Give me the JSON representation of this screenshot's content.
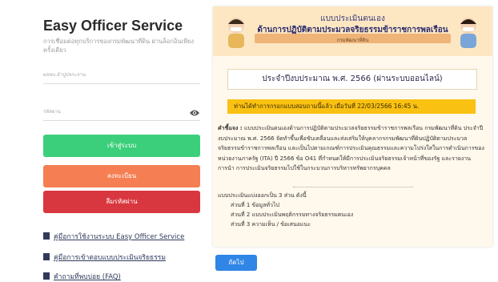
{
  "login": {
    "title": "Easy Officer Service",
    "subtitle": "การเชื่อมต่อทุกบริการของกรมพัฒนาที่ดิน ผ่านล็อกอินเพียงครั้งเดียว",
    "username_placeholder": "ผลขบ.อำปูปขระจาน",
    "password_placeholder": "รหัสผาน",
    "login_label": "เข้าสู่ระบบ",
    "register_label": "ลงทะเบียน",
    "forgot_label": "ลืมรหัสผ่าน",
    "links": [
      "คู่มือการใช้งานระบบ Easy Officer Service",
      "คู่มือการเข้าตอบแบบประเมินจริยธรรม",
      "คำถามที่พบบ่อย (FAQ)"
    ]
  },
  "form": {
    "banner_line1": "แบบประเมินตนเอง",
    "banner_line2": "ด้านการปฏิบัติตามประมวลจริยธรรมข้าราชการพลเรือน",
    "banner_line3": "กรมพัฒนาที่ดิน",
    "year_title": "ประจำปีงบประมาณ พ.ศ. 2566 (ผ่านระบบออนไลน์)",
    "notice": "ท่านได้ทำการกรอกแบบสอบถามนี้แล้ว เมื่อวันที่ 22/03/2566 16:45 น.",
    "explain_label": "คำชี้แจง :",
    "explain_text": "แบบประเมินตนเองด้านการปฏิบัติตามประมวลจริยธรรมข้าราชการพลเรือน กรมพัฒนาที่ดิน ประจำปี งบประมาณ พ.ศ. 2566 จัดทำขึ้นเพื่อขับเคลื่อนและส่งเสริมให้บุคลากรกรมพัฒนาที่ดินปฏิบัติตามประมวล จริยธรรมข้าราชการพลเรือน และเป็นไปตามเกณฑ์การประเมินคุณธรรมและความโปร่งใสในการดำเนินการของ หน่วยงานภาครัฐ (ITA) ปี 2566 ข้อ O41 ที่กำหนดให้มีการประเมินจริยธรรมเจ้าหน้าที่ของรัฐ และรายงานการนำ การประเมินจริยธรรมไปใช้ในกระบวนการบริหารทรัพยากรบุคคล",
    "parts_title": "แบบประเมินแบ่งออกเป็น 3 ส่วน ดังนี้",
    "parts": [
      "ส่วนที่ 1 ข้อมูลทั่วไป",
      "ส่วนที่ 2 แบบประเมินพฤติกรรมทางจริยธรรมตนเอง",
      "ส่วนที่ 3 ความเห็น / ข้อเสนอแนะ"
    ],
    "next_label": "ถัดไป"
  },
  "colors": {
    "login_button": "#3ccf7b",
    "register_button": "#f57f53",
    "forgot_button": "#d9373f",
    "notice_bg": "#f9c112",
    "next_button": "#2f86e6",
    "page_bg": "#fff8ec"
  }
}
